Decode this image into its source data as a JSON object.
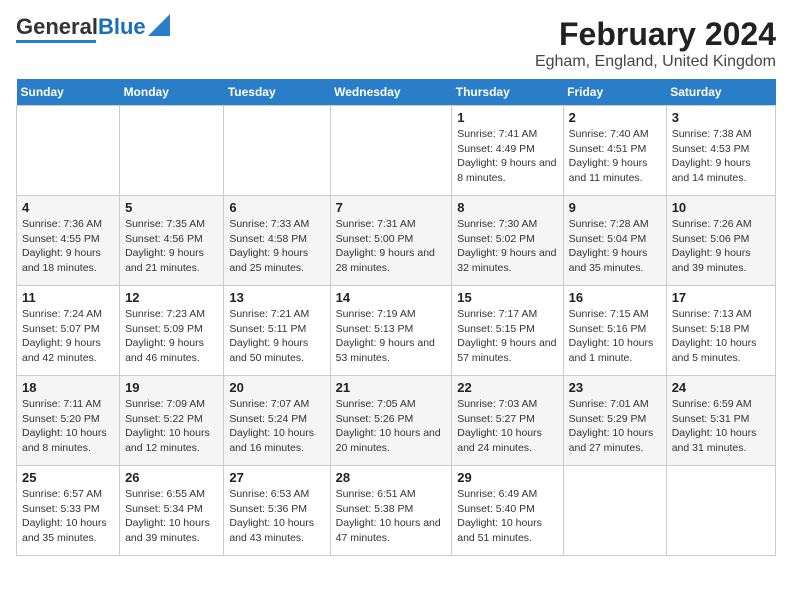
{
  "logo": {
    "part1": "General",
    "part2": "Blue"
  },
  "title": "February 2024",
  "subtitle": "Egham, England, United Kingdom",
  "days_of_week": [
    "Sunday",
    "Monday",
    "Tuesday",
    "Wednesday",
    "Thursday",
    "Friday",
    "Saturday"
  ],
  "weeks": [
    [
      {
        "day": "",
        "detail": ""
      },
      {
        "day": "",
        "detail": ""
      },
      {
        "day": "",
        "detail": ""
      },
      {
        "day": "",
        "detail": ""
      },
      {
        "day": "1",
        "detail": "Sunrise: 7:41 AM\nSunset: 4:49 PM\nDaylight: 9 hours\nand 8 minutes."
      },
      {
        "day": "2",
        "detail": "Sunrise: 7:40 AM\nSunset: 4:51 PM\nDaylight: 9 hours\nand 11 minutes."
      },
      {
        "day": "3",
        "detail": "Sunrise: 7:38 AM\nSunset: 4:53 PM\nDaylight: 9 hours\nand 14 minutes."
      }
    ],
    [
      {
        "day": "4",
        "detail": "Sunrise: 7:36 AM\nSunset: 4:55 PM\nDaylight: 9 hours\nand 18 minutes."
      },
      {
        "day": "5",
        "detail": "Sunrise: 7:35 AM\nSunset: 4:56 PM\nDaylight: 9 hours\nand 21 minutes."
      },
      {
        "day": "6",
        "detail": "Sunrise: 7:33 AM\nSunset: 4:58 PM\nDaylight: 9 hours\nand 25 minutes."
      },
      {
        "day": "7",
        "detail": "Sunrise: 7:31 AM\nSunset: 5:00 PM\nDaylight: 9 hours\nand 28 minutes."
      },
      {
        "day": "8",
        "detail": "Sunrise: 7:30 AM\nSunset: 5:02 PM\nDaylight: 9 hours\nand 32 minutes."
      },
      {
        "day": "9",
        "detail": "Sunrise: 7:28 AM\nSunset: 5:04 PM\nDaylight: 9 hours\nand 35 minutes."
      },
      {
        "day": "10",
        "detail": "Sunrise: 7:26 AM\nSunset: 5:06 PM\nDaylight: 9 hours\nand 39 minutes."
      }
    ],
    [
      {
        "day": "11",
        "detail": "Sunrise: 7:24 AM\nSunset: 5:07 PM\nDaylight: 9 hours\nand 42 minutes."
      },
      {
        "day": "12",
        "detail": "Sunrise: 7:23 AM\nSunset: 5:09 PM\nDaylight: 9 hours\nand 46 minutes."
      },
      {
        "day": "13",
        "detail": "Sunrise: 7:21 AM\nSunset: 5:11 PM\nDaylight: 9 hours\nand 50 minutes."
      },
      {
        "day": "14",
        "detail": "Sunrise: 7:19 AM\nSunset: 5:13 PM\nDaylight: 9 hours\nand 53 minutes."
      },
      {
        "day": "15",
        "detail": "Sunrise: 7:17 AM\nSunset: 5:15 PM\nDaylight: 9 hours\nand 57 minutes."
      },
      {
        "day": "16",
        "detail": "Sunrise: 7:15 AM\nSunset: 5:16 PM\nDaylight: 10 hours\nand 1 minute."
      },
      {
        "day": "17",
        "detail": "Sunrise: 7:13 AM\nSunset: 5:18 PM\nDaylight: 10 hours\nand 5 minutes."
      }
    ],
    [
      {
        "day": "18",
        "detail": "Sunrise: 7:11 AM\nSunset: 5:20 PM\nDaylight: 10 hours\nand 8 minutes."
      },
      {
        "day": "19",
        "detail": "Sunrise: 7:09 AM\nSunset: 5:22 PM\nDaylight: 10 hours\nand 12 minutes."
      },
      {
        "day": "20",
        "detail": "Sunrise: 7:07 AM\nSunset: 5:24 PM\nDaylight: 10 hours\nand 16 minutes."
      },
      {
        "day": "21",
        "detail": "Sunrise: 7:05 AM\nSunset: 5:26 PM\nDaylight: 10 hours\nand 20 minutes."
      },
      {
        "day": "22",
        "detail": "Sunrise: 7:03 AM\nSunset: 5:27 PM\nDaylight: 10 hours\nand 24 minutes."
      },
      {
        "day": "23",
        "detail": "Sunrise: 7:01 AM\nSunset: 5:29 PM\nDaylight: 10 hours\nand 27 minutes."
      },
      {
        "day": "24",
        "detail": "Sunrise: 6:59 AM\nSunset: 5:31 PM\nDaylight: 10 hours\nand 31 minutes."
      }
    ],
    [
      {
        "day": "25",
        "detail": "Sunrise: 6:57 AM\nSunset: 5:33 PM\nDaylight: 10 hours\nand 35 minutes."
      },
      {
        "day": "26",
        "detail": "Sunrise: 6:55 AM\nSunset: 5:34 PM\nDaylight: 10 hours\nand 39 minutes."
      },
      {
        "day": "27",
        "detail": "Sunrise: 6:53 AM\nSunset: 5:36 PM\nDaylight: 10 hours\nand 43 minutes."
      },
      {
        "day": "28",
        "detail": "Sunrise: 6:51 AM\nSunset: 5:38 PM\nDaylight: 10 hours\nand 47 minutes."
      },
      {
        "day": "29",
        "detail": "Sunrise: 6:49 AM\nSunset: 5:40 PM\nDaylight: 10 hours\nand 51 minutes."
      },
      {
        "day": "",
        "detail": ""
      },
      {
        "day": "",
        "detail": ""
      }
    ]
  ]
}
